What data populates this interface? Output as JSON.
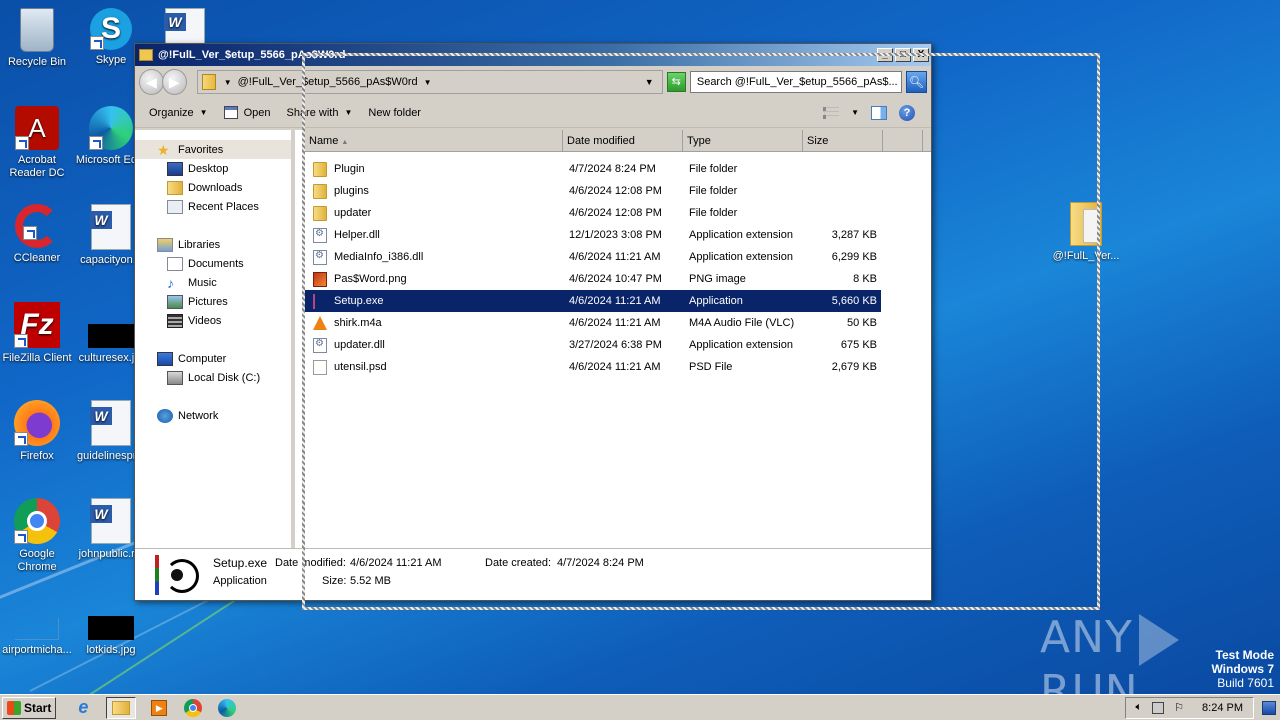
{
  "desktop": {
    "icons": [
      {
        "label": "Recycle Bin",
        "icon": "recycle-bin-icon"
      },
      {
        "label": "Skype",
        "icon": "skype-icon"
      },
      {
        "label": "Acrobat Reader DC",
        "icon": "acrobat-icon"
      },
      {
        "label": "Microsoft Ed...",
        "icon": "edge-icon"
      },
      {
        "label": "CCleaner",
        "icon": "ccleaner-icon"
      },
      {
        "label": "capacityon...",
        "icon": "word-doc-icon"
      },
      {
        "label": "FileZilla Client",
        "icon": "filezilla-icon"
      },
      {
        "label": "culturesex.j...",
        "icon": "image-file-icon"
      },
      {
        "label": "Firefox",
        "icon": "firefox-icon"
      },
      {
        "label": "guidelinespr...",
        "icon": "word-doc-icon"
      },
      {
        "label": "Google Chrome",
        "icon": "chrome-icon"
      },
      {
        "label": "johnpublic.r...",
        "icon": "word-doc-icon"
      },
      {
        "label": "airportmicha...",
        "icon": "image-file-icon"
      },
      {
        "label": "lotkids.jpg",
        "icon": "image-file-icon"
      },
      {
        "label": "@!FulL_Ver...",
        "icon": "folder-icon"
      }
    ]
  },
  "window": {
    "title": "@!FulL_Ver_$etup_5566_pAs$W0rd",
    "controls": {
      "minimize": "_",
      "maximize": "□",
      "close": "X"
    },
    "address": {
      "path": "@!FulL_Ver_$etup_5566_pAs$W0rd"
    },
    "search": {
      "placeholder": "Search @!FulL_Ver_$etup_5566_pAs$..."
    },
    "toolbar": {
      "organize": "Organize",
      "open": "Open",
      "share_with": "Share with",
      "new_folder": "New folder"
    },
    "nav": {
      "favorites": "Favorites",
      "favorites_items": [
        "Desktop",
        "Downloads",
        "Recent Places"
      ],
      "libraries": "Libraries",
      "libraries_items": [
        "Documents",
        "Music",
        "Pictures",
        "Videos"
      ],
      "computer": "Computer",
      "computer_items": [
        "Local Disk (C:)"
      ],
      "network": "Network"
    },
    "columns": {
      "name": "Name",
      "date": "Date modified",
      "type": "Type",
      "size": "Size"
    },
    "files": [
      {
        "name": "Plugin",
        "date": "4/7/2024 8:24 PM",
        "type": "File folder",
        "size": "",
        "kind": "folder"
      },
      {
        "name": "plugins",
        "date": "4/6/2024 12:08 PM",
        "type": "File folder",
        "size": "",
        "kind": "folder"
      },
      {
        "name": "updater",
        "date": "4/6/2024 12:08 PM",
        "type": "File folder",
        "size": "",
        "kind": "folder"
      },
      {
        "name": "Helper.dll",
        "date": "12/1/2023 3:08 PM",
        "type": "Application extension",
        "size": "3,287 KB",
        "kind": "dll"
      },
      {
        "name": "MediaInfo_i386.dll",
        "date": "4/6/2024 11:21 AM",
        "type": "Application extension",
        "size": "6,299 KB",
        "kind": "dll"
      },
      {
        "name": "Pas$Word.png",
        "date": "4/6/2024 10:47 PM",
        "type": "PNG image",
        "size": "8 KB",
        "kind": "png"
      },
      {
        "name": "Setup.exe",
        "date": "4/6/2024 11:21 AM",
        "type": "Application",
        "size": "5,660 KB",
        "kind": "exe",
        "selected": true
      },
      {
        "name": "shirk.m4a",
        "date": "4/6/2024 11:21 AM",
        "type": "M4A Audio File (VLC)",
        "size": "50 KB",
        "kind": "vlc"
      },
      {
        "name": "updater.dll",
        "date": "3/27/2024 6:38 PM",
        "type": "Application extension",
        "size": "675 KB",
        "kind": "dll"
      },
      {
        "name": "utensil.psd",
        "date": "4/6/2024 11:21 AM",
        "type": "PSD File",
        "size": "2,679 KB",
        "kind": "psd"
      }
    ],
    "details": {
      "name": "Setup.exe",
      "type": "Application",
      "date_modified_label": "Date modified:",
      "date_modified": "4/6/2024 11:21 AM",
      "size_label": "Size:",
      "size": "5.52 MB",
      "date_created_label": "Date created:",
      "date_created": "4/7/2024 8:24 PM"
    }
  },
  "watermark": {
    "text_left": "ANY",
    "text_right": "RUN"
  },
  "os_info": {
    "line1": "Test Mode",
    "line2": "Windows 7",
    "line3": "Build 7601"
  },
  "taskbar": {
    "start": "Start",
    "clock": "8:24 PM",
    "pinned": [
      "internet-explorer-icon",
      "explorer-icon",
      "media-player-icon",
      "chrome-icon",
      "edge-icon"
    ]
  }
}
